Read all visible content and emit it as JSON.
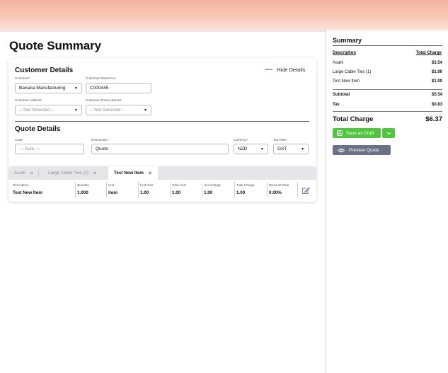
{
  "page": {
    "title": "Quote Summary"
  },
  "customer_details": {
    "title": "Customer Details",
    "hide_label": "Hide Details",
    "customer_label": "Customer",
    "customer_value": "Banana Manufacturing",
    "reference_label": "Customer Reference",
    "reference_value": "C000445",
    "address_label": "Customer Address",
    "address_value": "-- Not Selected --",
    "email_label": "Customer Email Address",
    "email_value": "-- Not Selected --"
  },
  "quote_details": {
    "title": "Quote Details",
    "code_label": "Code",
    "code_value": "--- Auto ---",
    "description_label": "Description",
    "description_value": "Quote",
    "currency_label": "Currency",
    "currency_value": "NZD",
    "tax_label": "Tax Rate",
    "tax_value": "GST"
  },
  "tabs": [
    {
      "label": "Asahi"
    },
    {
      "label": "Large Cable Ties (1)"
    },
    {
      "label": "Test New Item"
    }
  ],
  "line_item": {
    "headers": [
      "Description",
      "Quantity",
      "Unit",
      "Unit Cost",
      "Total Cost",
      "Unit Charge",
      "Total Charge",
      "Discount Rate"
    ],
    "values": [
      "Test New Item",
      "1.000",
      "item",
      "1.00",
      "1.00",
      "1.00",
      "1.00",
      "0.00%"
    ]
  },
  "summary": {
    "title": "Summary",
    "col_description": "Description",
    "col_total": "Total Charge",
    "lines": [
      {
        "label": "Asahi",
        "value": "$3.54"
      },
      {
        "label": "Large Cable Ties (1)",
        "value": "$1.00"
      },
      {
        "label": "Test New Item",
        "value": "$1.00"
      }
    ],
    "subtotal_label": "Subtotal",
    "subtotal_value": "$5.54",
    "tax_label": "Tax",
    "tax_value": "$0.83",
    "total_label": "Total Charge",
    "total_value": "$6.37",
    "save_draft_label": "Save as Draft",
    "preview_label": "Preview Quote"
  },
  "colors": {
    "accent_green": "#52c441",
    "preview_grey": "#6b7287",
    "required": "#e0443a"
  }
}
